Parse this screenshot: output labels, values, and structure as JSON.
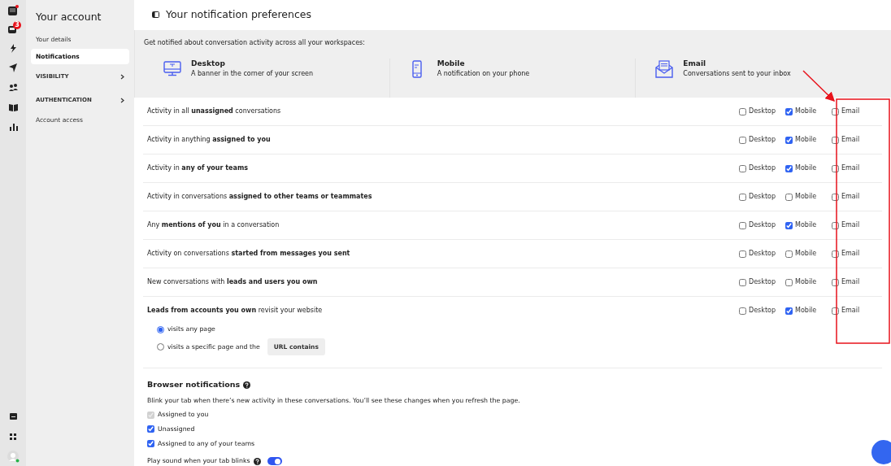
{
  "rail": {
    "inbox_badge": "3"
  },
  "account_nav": {
    "title": "Your account",
    "items": [
      {
        "kind": "link",
        "label": "Your details",
        "selected": false
      },
      {
        "kind": "link",
        "label": "Notifications",
        "selected": true
      },
      {
        "kind": "group",
        "label": "VISIBILITY",
        "selected": false
      },
      {
        "kind": "group",
        "label": "AUTHENTICATION",
        "selected": false
      },
      {
        "kind": "link",
        "label": "Account access",
        "selected": false
      }
    ]
  },
  "page_title": "Your notification preferences",
  "channels_intro": "Get notified about conversation activity across all your workspaces:",
  "channels": [
    {
      "kind": "desktop",
      "name": "Desktop",
      "description": "A banner in the corner of your screen"
    },
    {
      "kind": "mobile",
      "name": "Mobile",
      "description": "A notification on your phone"
    },
    {
      "kind": "email",
      "name": "Email",
      "description": "Conversations sent to your inbox"
    }
  ],
  "rules": [
    {
      "text": "Activity in all **unassigned** conversations",
      "checks": [
        {
          "label": "Desktop",
          "checked": false
        },
        {
          "label": "Mobile",
          "checked": true
        },
        {
          "label": "Email",
          "checked": false
        }
      ]
    },
    {
      "text": "Activity in anything **assigned to you**",
      "checks": [
        {
          "label": "Desktop",
          "checked": false
        },
        {
          "label": "Mobile",
          "checked": true
        },
        {
          "label": "Email",
          "checked": false
        }
      ]
    },
    {
      "text": "Activity in **any of your teams**",
      "checks": [
        {
          "label": "Desktop",
          "checked": false
        },
        {
          "label": "Mobile",
          "checked": true
        },
        {
          "label": "Email",
          "checked": false
        }
      ]
    },
    {
      "text": "Activity in conversations **assigned to other teams or teammates**",
      "checks": [
        {
          "label": "Desktop",
          "checked": false
        },
        {
          "label": "Mobile",
          "checked": false
        },
        {
          "label": "Email",
          "checked": false
        }
      ]
    },
    {
      "text": "Any **mentions of you** in a conversation",
      "checks": [
        {
          "label": "Desktop",
          "checked": false
        },
        {
          "label": "Mobile",
          "checked": true
        },
        {
          "label": "Email",
          "checked": false
        }
      ]
    },
    {
      "text": "Activity on conversations **started from messages you sent**",
      "checks": [
        {
          "label": "Desktop",
          "checked": false
        },
        {
          "label": "Mobile",
          "checked": false
        },
        {
          "label": "Email",
          "checked": false
        }
      ]
    },
    {
      "text": "New conversations with **leads and users you own**",
      "checks": [
        {
          "label": "Desktop",
          "checked": false
        },
        {
          "label": "Mobile",
          "checked": false
        },
        {
          "label": "Email",
          "checked": false
        }
      ]
    },
    {
      "text": "**Leads from accounts you own** revisit your website",
      "checks": [
        {
          "label": "Desktop",
          "checked": false
        },
        {
          "label": "Mobile",
          "checked": true
        },
        {
          "label": "Email",
          "checked": false
        }
      ],
      "options": [
        {
          "label": "visits any page",
          "selected": true
        },
        {
          "label": "visits a specific page and the",
          "selected": false,
          "button": "URL contains"
        }
      ]
    }
  ],
  "browser_notifications": {
    "title": "Browser notifications",
    "description": "Blink your tab when there’s new activity in these conversations. You’ll see these changes when you refresh the page.",
    "options": [
      {
        "label": "Assigned to you",
        "checked": true,
        "disabled": true
      },
      {
        "label": "Unassigned",
        "checked": true,
        "disabled": false
      },
      {
        "label": "Assigned to any of your teams",
        "checked": true,
        "disabled": false
      }
    ],
    "sound": {
      "label": "Play sound when your tab blinks",
      "on": true
    }
  }
}
